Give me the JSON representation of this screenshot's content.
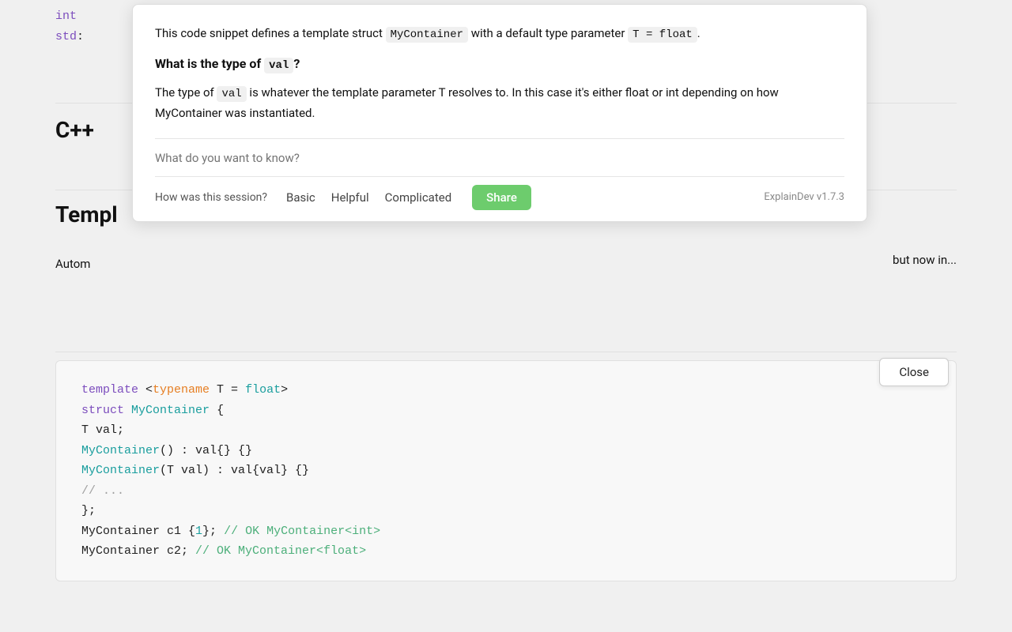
{
  "page": {
    "background": "#f0f0f0"
  },
  "popup": {
    "explanation_line1": "This code snippet defines a template struct ",
    "struct_name": "MyContainer",
    "explanation_line2": " with a default type parameter ",
    "default_param": "T = float",
    "explanation_line3": ".",
    "question_prefix": "What is the type of ",
    "question_val": "val",
    "question_suffix": "?",
    "answer_prefix": "The type of ",
    "answer_val": "val",
    "answer_suffix": " is whatever the template parameter T resolves to. In this case it's either float or int depending on how MyContainer was instantiated.",
    "input_placeholder": "What do you want to know?",
    "footer": {
      "session_label": "How was this session?",
      "btn_basic": "Basic",
      "btn_helpful": "Helpful",
      "btn_complicated": "Complicated",
      "btn_share": "Share",
      "version": "ExplainDev v1.7.3"
    }
  },
  "left_content": {
    "cpp_heading": "C++",
    "template_heading": "Templ",
    "description_left": "Autom",
    "description_right": "but now in..."
  },
  "code_block": {
    "lines": [
      {
        "parts": [
          {
            "text": "template",
            "class": "kw-blue"
          },
          {
            "text": " <",
            "class": "plain"
          },
          {
            "text": "typename",
            "class": "kw-orange"
          },
          {
            "text": " T = ",
            "class": "plain"
          },
          {
            "text": "float",
            "class": "kw-teal"
          },
          {
            "text": ">",
            "class": "plain"
          }
        ]
      },
      {
        "parts": [
          {
            "text": "struct",
            "class": "kw-blue"
          },
          {
            "text": " ",
            "class": "plain"
          },
          {
            "text": "MyContainer",
            "class": "kw-green"
          },
          {
            "text": " {",
            "class": "plain"
          }
        ]
      },
      {
        "parts": [
          {
            "text": "    T val;",
            "class": "plain"
          }
        ]
      },
      {
        "parts": [
          {
            "text": "    ",
            "class": "plain"
          },
          {
            "text": "MyContainer",
            "class": "kw-green"
          },
          {
            "text": "() : val{} {}",
            "class": "plain"
          }
        ]
      },
      {
        "parts": [
          {
            "text": "    ",
            "class": "plain"
          },
          {
            "text": "MyContainer",
            "class": "kw-green"
          },
          {
            "text": "(T val) : val{val} {}",
            "class": "plain"
          }
        ]
      },
      {
        "parts": [
          {
            "text": "    // ...",
            "class": "comment"
          }
        ]
      },
      {
        "parts": [
          {
            "text": "};",
            "class": "plain"
          }
        ]
      },
      {
        "parts": [
          {
            "text": "MyContainer c1 {",
            "class": "plain"
          },
          {
            "text": "1",
            "class": "kw-teal"
          },
          {
            "text": "};",
            "class": "plain"
          },
          {
            "text": " // OK MyContainer<int>",
            "class": "ok-comment"
          }
        ]
      },
      {
        "parts": [
          {
            "text": "MyContainer c2;",
            "class": "plain"
          },
          {
            "text": " // OK MyContainer<float>",
            "class": "ok-comment"
          }
        ]
      }
    ]
  },
  "close_button": {
    "label": "Close"
  }
}
